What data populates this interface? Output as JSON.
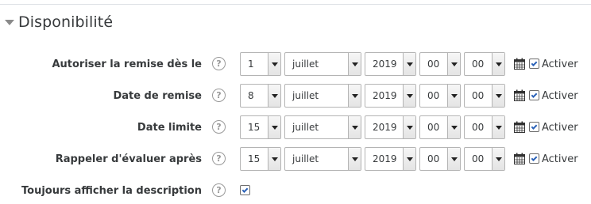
{
  "section": {
    "title": "Disponibilité"
  },
  "enable_label": "Activer",
  "rows": [
    {
      "label": "Autoriser la remise dès le",
      "day": "1",
      "month": "juillet",
      "year": "2019",
      "hour": "00",
      "minute": "00",
      "enabled": true
    },
    {
      "label": "Date de remise",
      "day": "8",
      "month": "juillet",
      "year": "2019",
      "hour": "00",
      "minute": "00",
      "enabled": true
    },
    {
      "label": "Date limite",
      "day": "15",
      "month": "juillet",
      "year": "2019",
      "hour": "00",
      "minute": "00",
      "enabled": true
    },
    {
      "label": "Rappeler d'évaluer après",
      "day": "15",
      "month": "juillet",
      "year": "2019",
      "hour": "00",
      "minute": "00",
      "enabled": true
    }
  ],
  "always_show_description": {
    "label": "Toujours afficher la description",
    "checked": true
  },
  "icons": {
    "help": "help-icon",
    "calendar": "calendar-icon",
    "collapse": "caret-down-icon"
  },
  "colors": {
    "checkmark": "#2b62b8",
    "text": "#373a3c",
    "border": "#b4b4b4"
  }
}
